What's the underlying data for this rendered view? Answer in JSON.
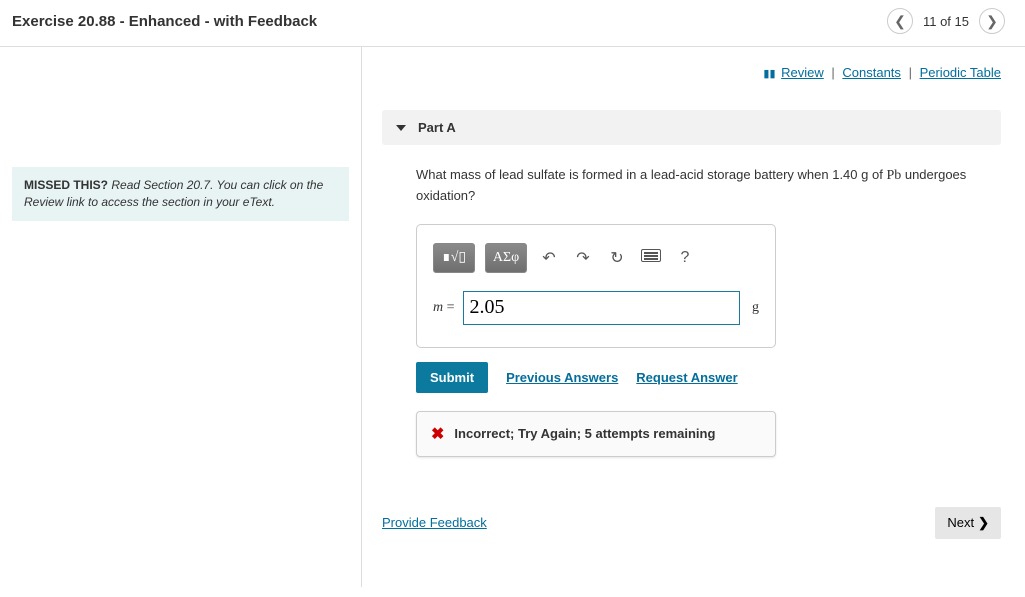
{
  "header": {
    "title": "Exercise 20.88 - Enhanced - with Feedback",
    "page_counter": "11 of 15"
  },
  "sidebar": {
    "hint_label": "MISSED THIS?",
    "hint_text": " Read Section 20.7. You can click on the Review link to access the section in your eText."
  },
  "top_links": {
    "review": "Review",
    "constants": "Constants",
    "periodic": "Periodic Table"
  },
  "part": {
    "label": "Part A",
    "question_prefix": "What mass of lead sulfate is formed in a lead-acid storage battery when 1.40 ",
    "question_unit1": "g",
    "question_mid": " of ",
    "element": "Pb",
    "question_suffix": " undergoes oxidation?"
  },
  "toolbar": {
    "template_btn": "∎√▯",
    "greek_btn": "ΑΣφ",
    "undo_icon": "↶",
    "redo_icon": "↷",
    "redo2_icon": "↻",
    "help_icon": "?"
  },
  "answer": {
    "var_label": "m",
    "eq": " = ",
    "value": "2.05",
    "unit": "g"
  },
  "actions": {
    "submit": "Submit",
    "previous": "Previous Answers",
    "request": "Request Answer"
  },
  "feedback": {
    "text": "Incorrect; Try Again; 5 attempts remaining"
  },
  "bottom": {
    "provide": "Provide Feedback",
    "next": "Next"
  }
}
